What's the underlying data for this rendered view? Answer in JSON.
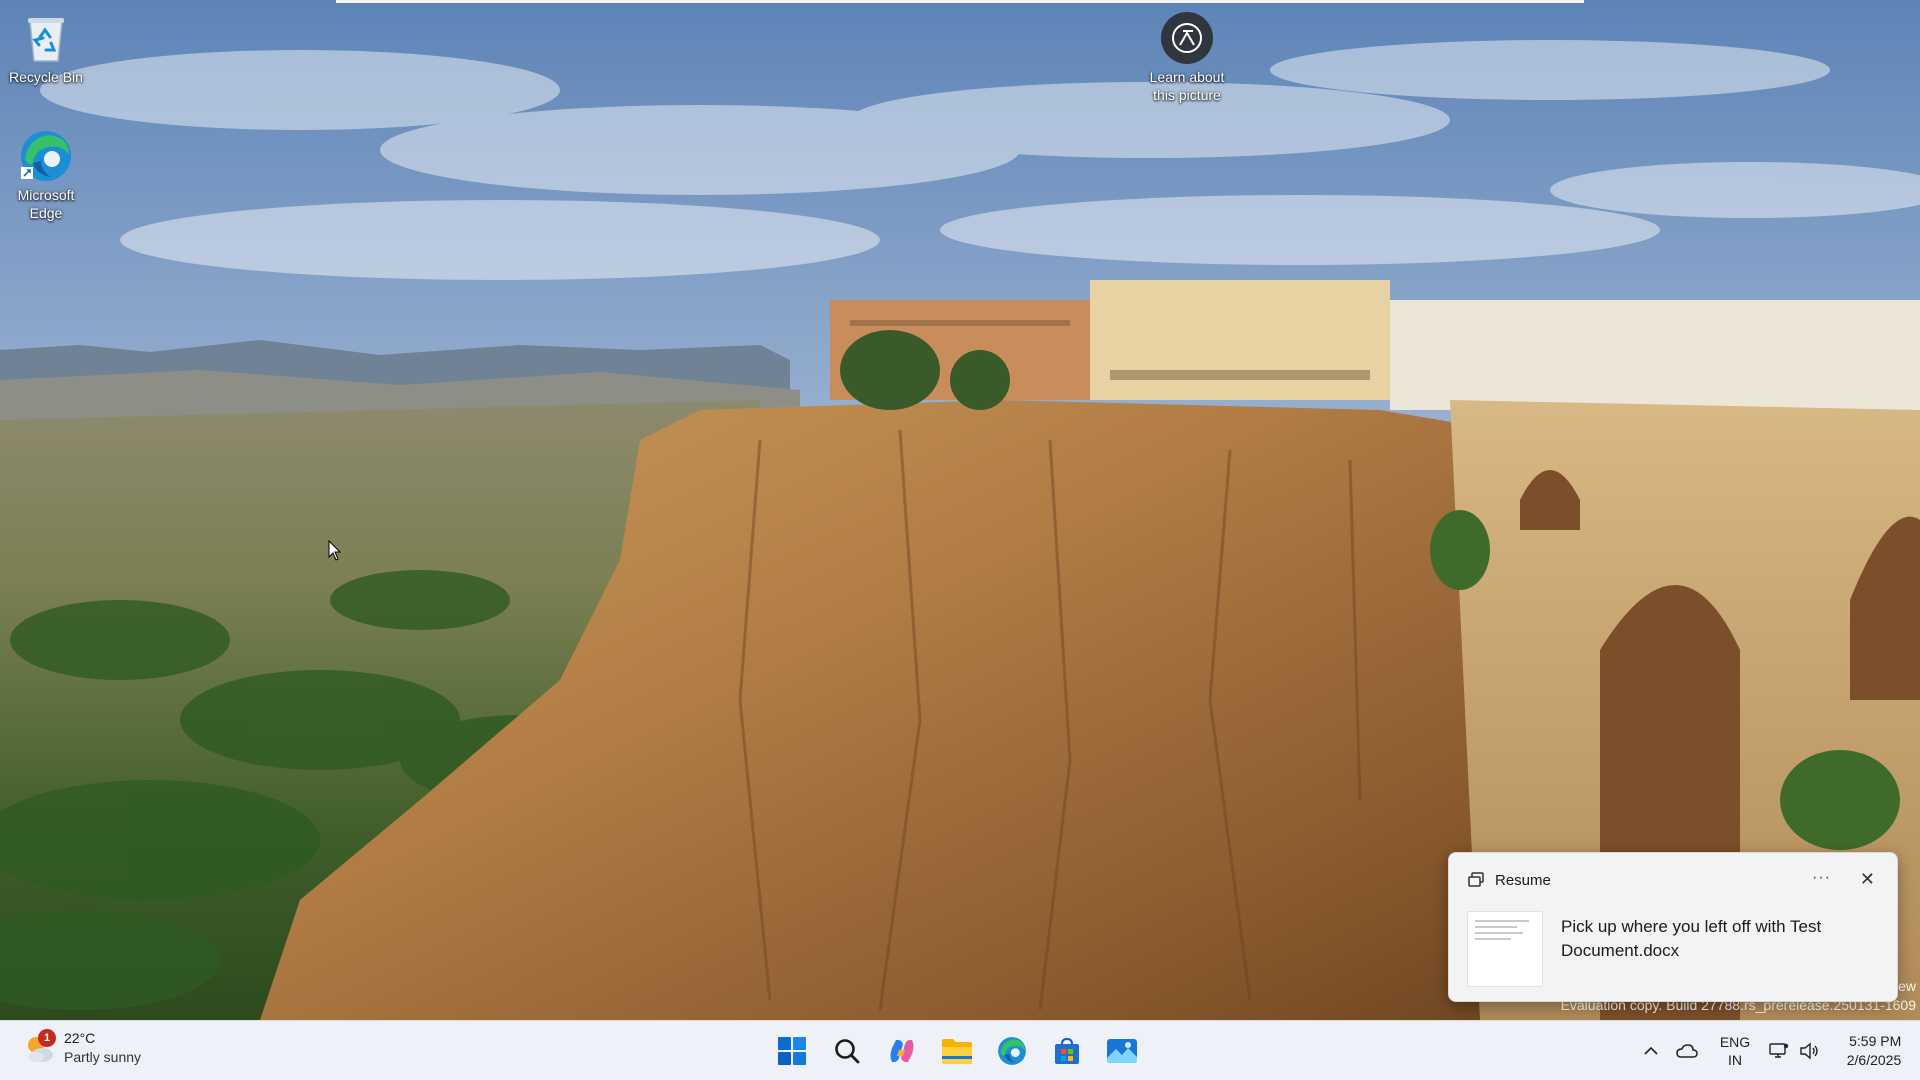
{
  "desktop": {
    "icons": [
      {
        "label": "Recycle Bin",
        "icon": "recycle-bin-icon"
      },
      {
        "label": "Microsoft Edge",
        "icon": "edge-icon"
      }
    ],
    "learn_picture": {
      "label": "Learn about this picture",
      "icon": "camera-info-icon"
    }
  },
  "watermark": {
    "line_top": "ew",
    "line_bottom": "Evaluation copy. Build 27788.rs_prerelease.250131-1609"
  },
  "notification": {
    "title": "Resume",
    "more_label": "···",
    "close_label": "✕",
    "message": "Pick up where you left off with Test Document.docx"
  },
  "taskbar": {
    "weather": {
      "temperature": "22°C",
      "condition": "Partly sunny",
      "badge_count": "1"
    },
    "pinned": [
      {
        "name": "start-button",
        "icon": "windows-logo-icon"
      },
      {
        "name": "search-button",
        "icon": "search-icon"
      },
      {
        "name": "copilot-button",
        "icon": "copilot-icon"
      },
      {
        "name": "file-explorer-button",
        "icon": "folder-icon"
      },
      {
        "name": "edge-taskbar-button",
        "icon": "edge-icon"
      },
      {
        "name": "store-button",
        "icon": "store-icon"
      },
      {
        "name": "photos-button",
        "icon": "photos-icon"
      }
    ],
    "tray": {
      "language_top": "ENG",
      "language_bottom": "IN",
      "time": "5:59 PM",
      "date": "2/6/2025"
    }
  },
  "colors": {
    "accent": "#0067c0",
    "taskbar_bg": "#eef1f7",
    "badge_red": "#c42b1c"
  }
}
